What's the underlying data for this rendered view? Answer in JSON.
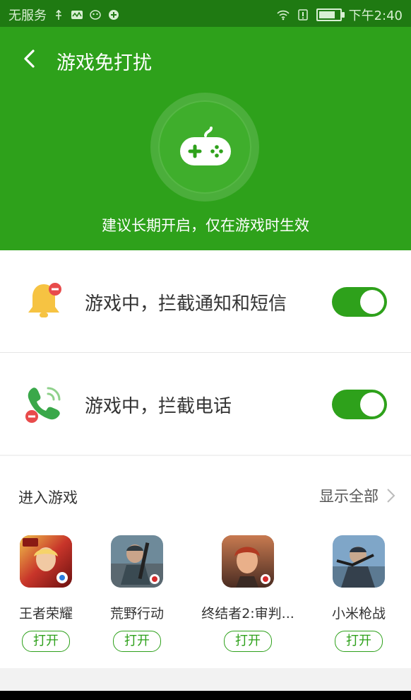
{
  "status_bar": {
    "carrier": "无服务",
    "time": "下午2:40",
    "icons": [
      "usb-icon",
      "activity-icon",
      "mask-icon",
      "app-icon",
      "wifi-icon",
      "sim-alert-icon",
      "battery-icon"
    ]
  },
  "header": {
    "title": "游戏免打扰",
    "tip": "建议长期开启，仅在游戏时生效",
    "bg_color": "#2ea11b"
  },
  "settings": [
    {
      "label": "游戏中，拦截通知和短信",
      "icon": "bell-block-icon",
      "enabled": true
    },
    {
      "label": "游戏中，拦截电话",
      "icon": "phone-block-icon",
      "enabled": true
    }
  ],
  "games_section": {
    "title": "进入游戏",
    "show_all": "显示全部",
    "open_label": "打开",
    "games": [
      {
        "name": "王者荣耀"
      },
      {
        "name": "荒野行动"
      },
      {
        "name": "终结者2:审判..."
      },
      {
        "name": "小米枪战"
      }
    ]
  }
}
